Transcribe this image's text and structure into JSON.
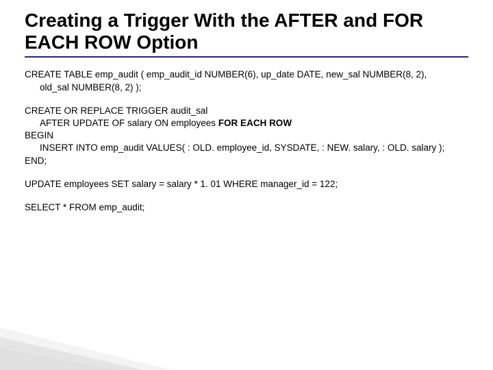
{
  "title": "Creating a Trigger With the AFTER and FOR EACH ROW Option",
  "block1": {
    "l1": "CREATE TABLE emp_audit ( emp_audit_id NUMBER(6), up_date DATE, new_sal NUMBER(8, 2),",
    "l2": "old_sal NUMBER(8, 2) );"
  },
  "block2": {
    "l1": "CREATE OR REPLACE TRIGGER audit_sal",
    "l2a": "AFTER UPDATE OF salary ON employees ",
    "l2b": "FOR EACH ROW",
    "l3": "BEGIN",
    "l4": "INSERT INTO emp_audit VALUES( : OLD. employee_id, SYSDATE, : NEW. salary, : OLD. salary );",
    "l5": "END;"
  },
  "block3": {
    "l1": "UPDATE employees SET salary = salary * 1. 01 WHERE manager_id = 122;"
  },
  "block4": {
    "l1": "SELECT * FROM emp_audit;"
  }
}
